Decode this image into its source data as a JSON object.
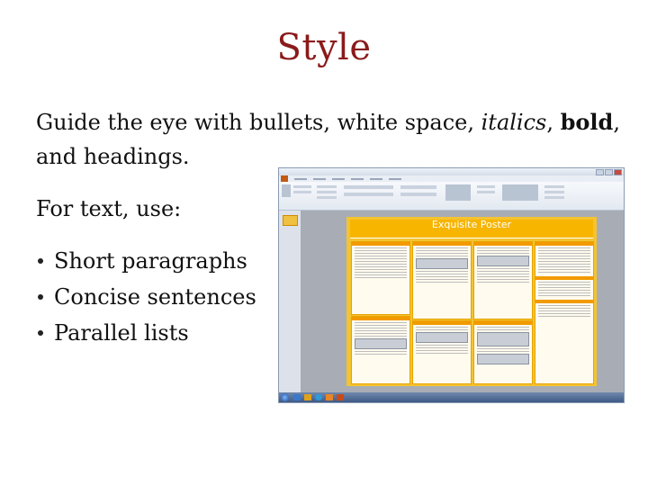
{
  "title": "Style",
  "intro": {
    "part1": "Guide the eye with bullets, white space, ",
    "italics": "italics",
    "sep": ", ",
    "bold": "bold",
    "part2": ", and headings."
  },
  "for_text": "For text, use:",
  "bullets": [
    "Short paragraphs",
    "Concise sentences",
    "Parallel lists"
  ],
  "screenshot": {
    "poster_title": "Exquisite Poster",
    "colors": {
      "poster_bg": "#f4c330",
      "poster_header": "#f7b500",
      "file_tab": "#c15a13"
    },
    "icons": [
      "start-orb-icon",
      "windows-explorer-icon",
      "internet-explorer-icon",
      "powerpoint-icon"
    ]
  }
}
